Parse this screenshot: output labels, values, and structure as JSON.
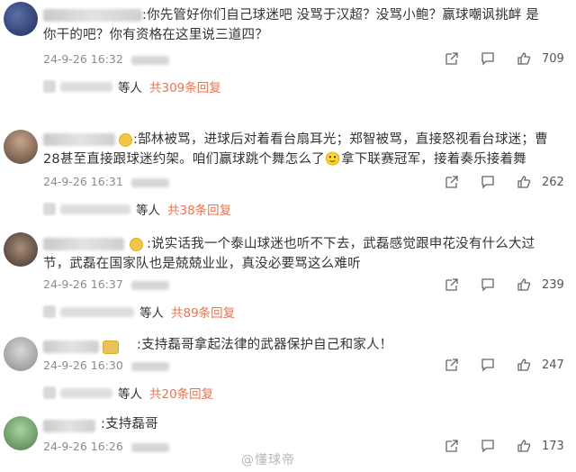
{
  "comments": [
    {
      "text": ":你先管好你们自己球迷吧 没骂于汉超？没骂小鲍？赢球嘲讽挑衅 是你干的吧？你有资格在这里说三道四？",
      "time": "24-9-26 16:32",
      "likes": "709",
      "reply_suffix": "等人",
      "reply_count": "共309条回复"
    },
    {
      "text": ":郜林被骂，进球后对着看台扇耳光；郑智被骂，直接怒视看台球迷；曹28甚至直接跟球迷约架。咱们赢球跳个舞怎么了🙂拿下联赛冠军，接着奏乐接着舞",
      "time": "24-9-26 16:31",
      "likes": "262",
      "reply_suffix": "等人",
      "reply_count": "共38条回复"
    },
    {
      "text": ":说实话我一个泰山球迷也听不下去，武磊感觉跟申花没有什么大过节，武磊在国家队也是兢兢业业，真没必要骂这么难听",
      "time": "24-9-26 16:37",
      "likes": "239",
      "reply_suffix": "等人",
      "reply_count": "共89条回复"
    },
    {
      "text": ":支持磊哥拿起法律的武器保护自己和家人！",
      "time": "24-9-26 16:30",
      "likes": "247",
      "reply_suffix": "等人",
      "reply_count": "共20条回复"
    },
    {
      "text": ":支持磊哥",
      "time": "24-9-26 16:26",
      "likes": "173"
    }
  ],
  "watermark": "@懂球帝",
  "colors": {
    "reply_accent": "#eb7350",
    "text": "#333333",
    "meta": "#8c8c8c"
  },
  "icons": [
    "share-icon",
    "comment-icon",
    "like-icon"
  ]
}
